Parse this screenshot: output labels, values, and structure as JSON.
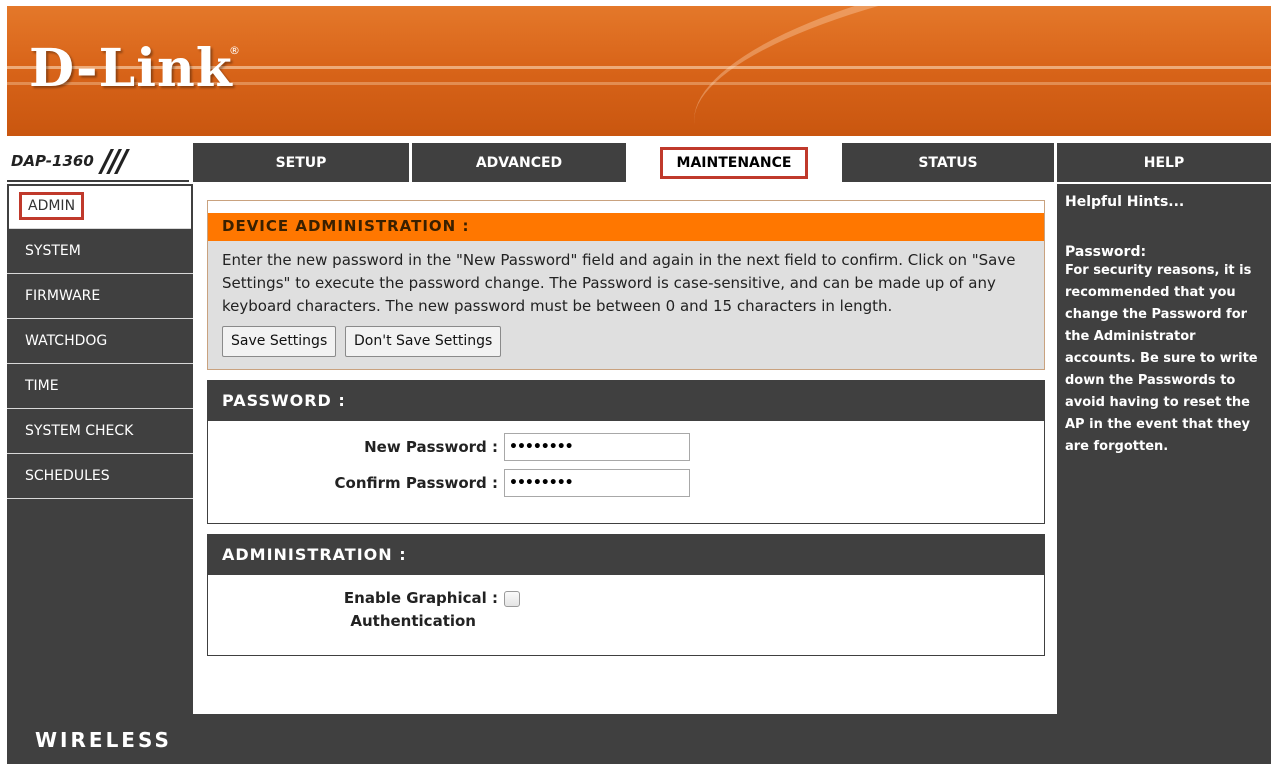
{
  "brand": {
    "logo_text": "D-Link",
    "registered": "®",
    "model": "DAP-1360",
    "footer": "WIRELESS",
    "accent_color": "#ff7700",
    "dark_color": "#404040",
    "highlight_color": "#c0392b"
  },
  "nav": {
    "tabs": [
      {
        "label": "SETUP"
      },
      {
        "label": "ADVANCED"
      },
      {
        "label": "MAINTENANCE",
        "active": true
      },
      {
        "label": "STATUS"
      },
      {
        "label": "HELP"
      }
    ]
  },
  "sidebar": {
    "items": [
      {
        "label": "ADMIN",
        "active": true
      },
      {
        "label": "SYSTEM"
      },
      {
        "label": "FIRMWARE"
      },
      {
        "label": "WATCHDOG"
      },
      {
        "label": "TIME"
      },
      {
        "label": "SYSTEM CHECK"
      },
      {
        "label": "SCHEDULES"
      }
    ]
  },
  "device_admin": {
    "title": "DEVICE ADMINISTRATION :",
    "description": "Enter the new password in the \"New Password\" field and again in the next field to confirm. Click on \"Save Settings\" to execute the password change. The Password is case-sensitive, and can be made up of any keyboard characters. The new password must be between 0 and 15 characters in length.",
    "save_label": "Save Settings",
    "dont_save_label": "Don't Save Settings"
  },
  "password": {
    "title": "PASSWORD :",
    "new_label": "New Password :",
    "new_value": "••••••••",
    "confirm_label": "Confirm Password :",
    "confirm_value": "••••••••"
  },
  "administration": {
    "title": "ADMINISTRATION :",
    "graphical_auth_label_line1": "Enable Graphical :",
    "graphical_auth_label_line2": "Authentication",
    "graphical_auth_checked": false
  },
  "help": {
    "title": "Helpful Hints...",
    "subtitle": "Password:",
    "body": "For security reasons, it is recommended that you change the Password for the Administrator accounts. Be sure to write down the Passwords to avoid having to reset the AP in the event that they are forgotten."
  }
}
